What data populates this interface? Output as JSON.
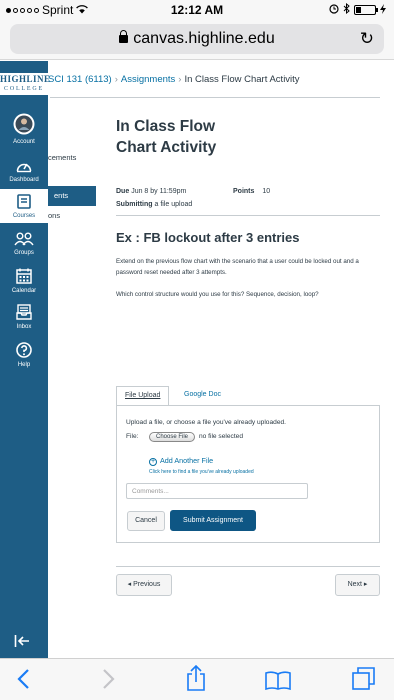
{
  "status_bar": {
    "carrier": "Sprint",
    "time": "12:12 AM"
  },
  "browser": {
    "url": "canvas.highline.edu"
  },
  "global_nav": {
    "logo_line1": "HIGHLINE",
    "logo_line2": "COLLEGE",
    "items": [
      {
        "label": "Account",
        "icon": "avatar-icon"
      },
      {
        "label": "Dashboard",
        "icon": "dashboard-icon"
      },
      {
        "label": "Courses",
        "icon": "courses-icon"
      },
      {
        "label": "Groups",
        "icon": "groups-icon"
      },
      {
        "label": "Calendar",
        "icon": "calendar-icon"
      },
      {
        "label": "Inbox",
        "icon": "inbox-icon"
      },
      {
        "label": "Help",
        "icon": "help-icon"
      }
    ]
  },
  "course_nav_fragments": [
    "cements",
    "ents",
    "ons"
  ],
  "breadcrumb": {
    "course": "SCI 131 (6113)",
    "section": "Assignments",
    "current": "In Class Flow Chart Activity"
  },
  "assignment": {
    "title": "In Class Flow Chart Activity",
    "due_label": "Due",
    "due_value": "Jun 8 by 11:59pm",
    "points_label": "Points",
    "points_value": "10",
    "submitting_label": "Submitting",
    "submitting_value": "a file upload",
    "heading": "Ex : FB lockout after 3 entries",
    "description_1": "Extend on the previous flow chart with the scenario that a user could be locked out and a password reset needed after 3 attempts.",
    "description_2": "Which control structure would you use for this? Sequence, decision, loop?"
  },
  "submission": {
    "tab_upload": "File Upload",
    "tab_google": "Google Doc",
    "prompt": "Upload a file, or choose a file you've already uploaded.",
    "file_label": "File:",
    "choose_button": "Choose File",
    "no_file": "no file selected",
    "add_another": "Add Another File",
    "find_link": "Click here to find a file you've already uploaded",
    "comments_placeholder": "Comments...",
    "cancel": "Cancel",
    "submit": "Submit Assignment"
  },
  "pagination": {
    "previous": "◂ Previous",
    "next": "Next ▸"
  },
  "colors": {
    "nav_blue": "#1e5d85",
    "link": "#0770a3",
    "submit": "#0e5684"
  }
}
